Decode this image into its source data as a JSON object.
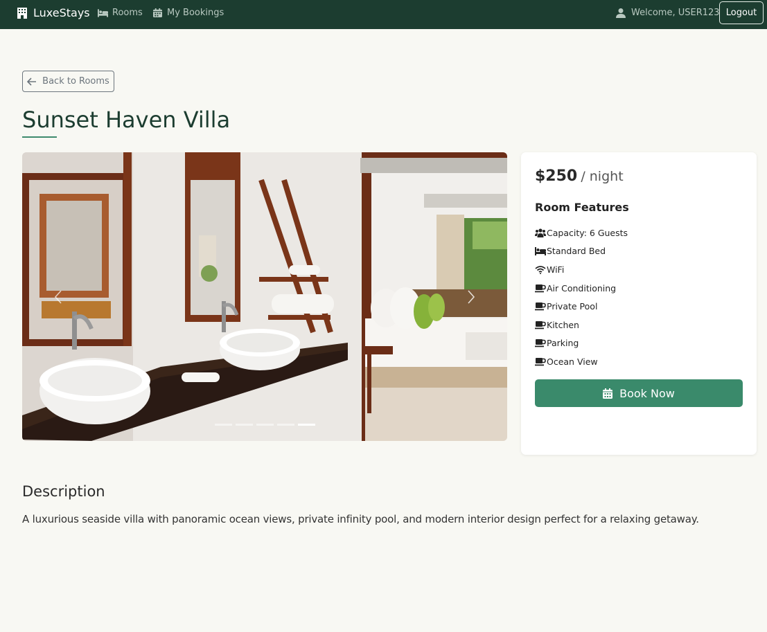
{
  "nav": {
    "brand": "LuxeStays",
    "rooms_label": "Rooms",
    "bookings_label": "My Bookings",
    "welcome_text": "Welcome, USER123",
    "logout_label": "Logout"
  },
  "back_label": "Back to Rooms",
  "room": {
    "title": "Sunset Haven Villa",
    "price": "$250",
    "price_unit": "/ night",
    "features_title": "Room Features",
    "features": [
      {
        "icon": "users-icon",
        "label": "Capacity: 6 Guests"
      },
      {
        "icon": "bed-icon",
        "label": "Standard Bed"
      },
      {
        "icon": "wifi-icon",
        "label": "WiFi"
      },
      {
        "icon": "mug-icon",
        "label": "Air Conditioning"
      },
      {
        "icon": "mug-icon",
        "label": "Private Pool"
      },
      {
        "icon": "mug-icon",
        "label": "Kitchen"
      },
      {
        "icon": "mug-icon",
        "label": "Parking"
      },
      {
        "icon": "mug-icon",
        "label": "Ocean View"
      }
    ],
    "book_label": "Book Now"
  },
  "carousel": {
    "slide_count": 5,
    "active_index": 4
  },
  "description": {
    "title": "Description",
    "text": "A luxurious seaside villa with panoramic ocean views, private infinity pool, and modern interior design perfect for a relaxing getaway."
  },
  "colors": {
    "navbar": "#1c3d30",
    "accent": "#3a8a6b",
    "title": "#1c3d30",
    "background": "#f8f8f3"
  }
}
